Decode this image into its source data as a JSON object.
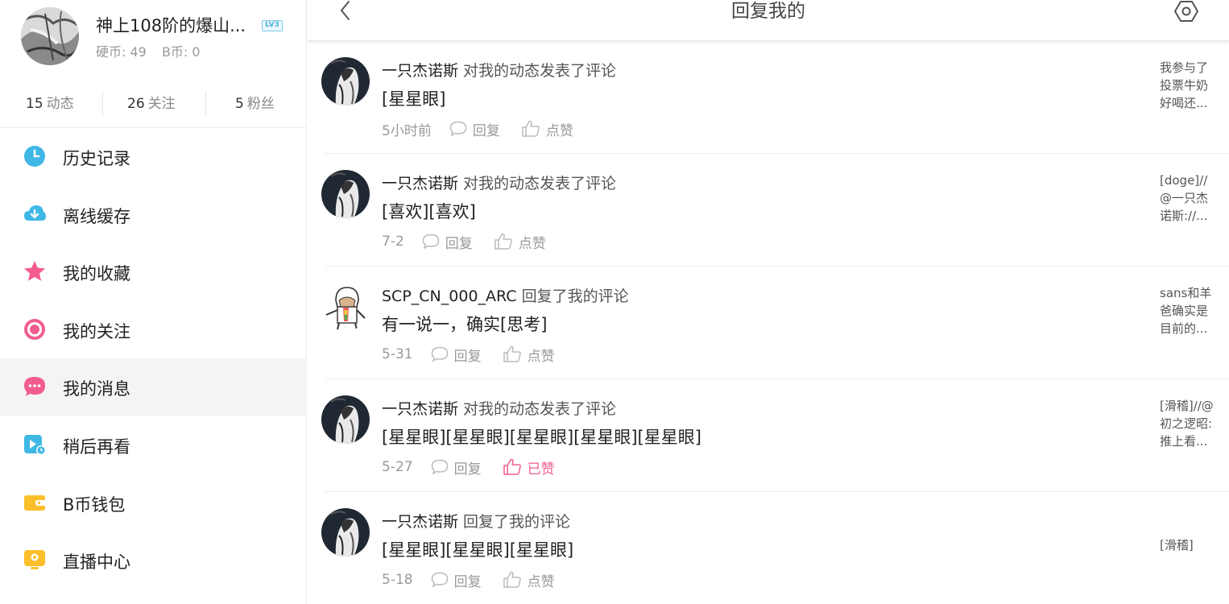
{
  "profile": {
    "username": "神上108阶的爆山...",
    "level": "LV3",
    "coins": "硬币: 49",
    "bcoins": "B币: 0"
  },
  "stats": [
    {
      "count": "15",
      "label": "动态"
    },
    {
      "count": "26",
      "label": "关注"
    },
    {
      "count": "5",
      "label": "粉丝"
    }
  ],
  "menu": [
    {
      "label": "历史记录",
      "icon": "clock-icon",
      "color": "#3fb8e6"
    },
    {
      "label": "离线缓存",
      "icon": "download-cloud-icon",
      "color": "#3fb8e6"
    },
    {
      "label": "我的收藏",
      "icon": "star-icon",
      "color": "#f25d8e"
    },
    {
      "label": "我的关注",
      "icon": "target-icon",
      "color": "#f25d8e"
    },
    {
      "label": "我的消息",
      "icon": "chat-bubble-icon",
      "color": "#f25d8e",
      "active": true
    },
    {
      "label": "稍后再看",
      "icon": "watch-later-icon",
      "color": "#3fb8e6"
    },
    {
      "label": "B币钱包",
      "icon": "wallet-icon",
      "color": "#fbbf2b"
    },
    {
      "label": "直播中心",
      "icon": "live-tv-icon",
      "color": "#fbbf2b"
    }
  ],
  "header": {
    "title": "回复我的"
  },
  "replies": [
    {
      "user": "一只杰诺斯",
      "action": "对我的动态发表了评论",
      "content": "[星星眼]",
      "time": "5小时前",
      "reply_label": "回复",
      "like_label": "点赞",
      "liked": false,
      "quote": [
        "我参与了",
        "投票牛奶",
        "好喝还..."
      ],
      "avatar": "dark-avatar"
    },
    {
      "user": "一只杰诺斯",
      "action": "对我的动态发表了评论",
      "content": "[喜欢][喜欢]",
      "time": "7-2",
      "reply_label": "回复",
      "like_label": "点赞",
      "liked": false,
      "quote": [
        "[doge]//",
        "@一只杰",
        "诺斯://..."
      ],
      "avatar": "dark-avatar"
    },
    {
      "user": "SCP_CN_000_ARC",
      "action": "回复了我的评论",
      "content": "有一说一，确实[思考]",
      "time": "5-31",
      "reply_label": "回复",
      "like_label": "点赞",
      "liked": false,
      "quote": [
        "sans和羊",
        "爸确实是",
        "目前的..."
      ],
      "avatar": "cartoon-avatar"
    },
    {
      "user": "一只杰诺斯",
      "action": "对我的动态发表了评论",
      "content": "[星星眼][星星眼][星星眼][星星眼][星星眼]",
      "time": "5-27",
      "reply_label": "回复",
      "like_label": "已赞",
      "liked": true,
      "quote": [
        "[滑稽]//@",
        "初之逻昭:",
        "推上看..."
      ],
      "avatar": "dark-avatar"
    },
    {
      "user": "一只杰诺斯",
      "action": "回复了我的评论",
      "content": "[星星眼][星星眼][星星眼]",
      "time": "5-18",
      "reply_label": "回复",
      "like_label": "点赞",
      "liked": false,
      "quote": [
        "[滑稽]"
      ],
      "avatar": "dark-avatar"
    }
  ],
  "colors": {
    "accent_pink": "#f25d8e",
    "accent_blue": "#3fb8e6",
    "accent_yellow": "#fbbf2b"
  }
}
